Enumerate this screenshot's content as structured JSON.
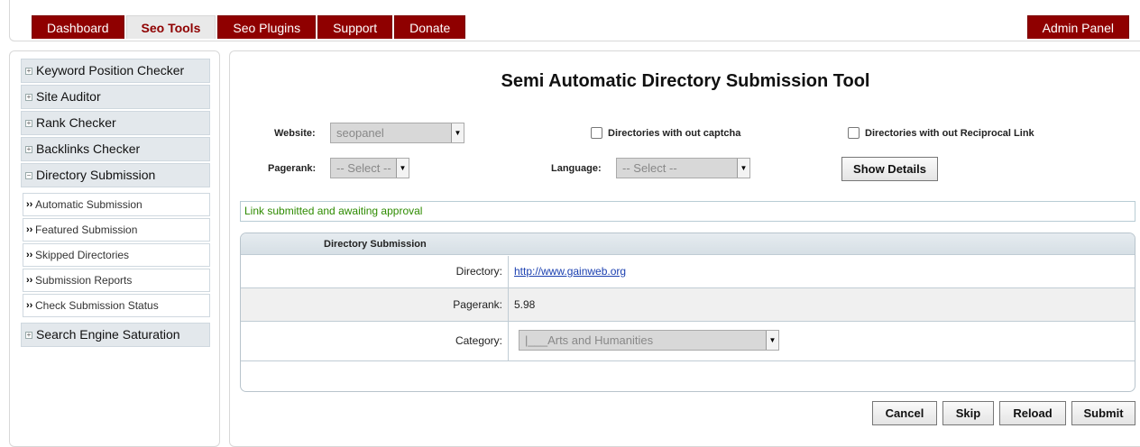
{
  "nav": {
    "tabs": [
      "Dashboard",
      "Seo Tools",
      "Seo Plugins",
      "Support",
      "Donate"
    ],
    "active": "Seo Tools",
    "admin": "Admin Panel"
  },
  "sidebar": {
    "menus": [
      "Keyword Position Checker",
      "Site Auditor",
      "Rank Checker",
      "Backlinks Checker",
      "Directory Submission"
    ],
    "submenu": [
      "Automatic Submission",
      "Featured Submission",
      "Skipped Directories",
      "Submission Reports",
      "Check Submission Status"
    ],
    "last_menu": "Search Engine Saturation"
  },
  "main": {
    "title": "Semi Automatic Directory Submission Tool",
    "website_label": "Website:",
    "website_value": "seopanel",
    "captcha_label": "Directories with out captcha",
    "reciprocal_label": "Directories with out Reciprocal Link",
    "pagerank_label": "Pagerank:",
    "pagerank_value": "-- Select --",
    "language_label": "Language:",
    "language_value": "-- Select --",
    "show_details": "Show Details",
    "notice": "Link submitted and awaiting approval",
    "panel_title": "Directory Submission",
    "directory_label": "Directory:",
    "directory_value": "http://www.gainweb.org",
    "pr_label": "Pagerank:",
    "pr_value": "5.98",
    "category_label": "Category:",
    "category_value": "|___Arts and Humanities",
    "buttons": {
      "cancel": "Cancel",
      "skip": "Skip",
      "reload": "Reload",
      "submit": "Submit"
    }
  },
  "colors": {
    "brand": "#8f0000",
    "notice": "#2e8b00"
  }
}
